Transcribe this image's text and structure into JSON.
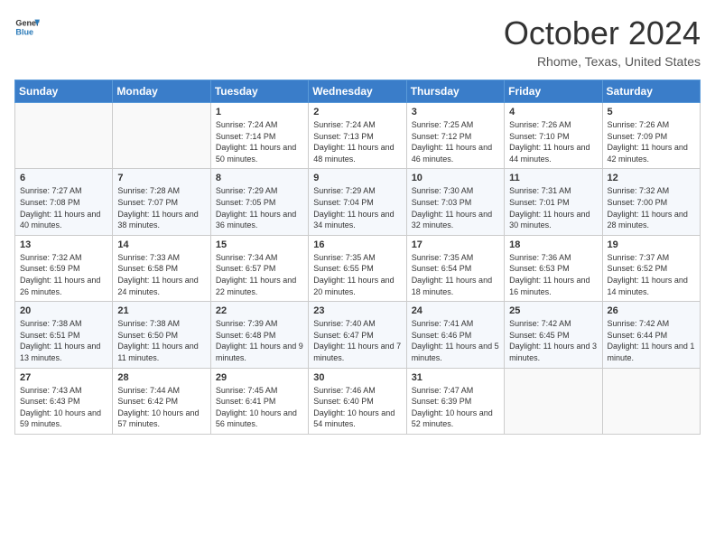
{
  "header": {
    "logo_general": "General",
    "logo_blue": "Blue",
    "month": "October 2024",
    "location": "Rhome, Texas, United States"
  },
  "weekdays": [
    "Sunday",
    "Monday",
    "Tuesday",
    "Wednesday",
    "Thursday",
    "Friday",
    "Saturday"
  ],
  "weeks": [
    [
      {
        "day": "",
        "info": ""
      },
      {
        "day": "",
        "info": ""
      },
      {
        "day": "1",
        "info": "Sunrise: 7:24 AM\nSunset: 7:14 PM\nDaylight: 11 hours and 50 minutes."
      },
      {
        "day": "2",
        "info": "Sunrise: 7:24 AM\nSunset: 7:13 PM\nDaylight: 11 hours and 48 minutes."
      },
      {
        "day": "3",
        "info": "Sunrise: 7:25 AM\nSunset: 7:12 PM\nDaylight: 11 hours and 46 minutes."
      },
      {
        "day": "4",
        "info": "Sunrise: 7:26 AM\nSunset: 7:10 PM\nDaylight: 11 hours and 44 minutes."
      },
      {
        "day": "5",
        "info": "Sunrise: 7:26 AM\nSunset: 7:09 PM\nDaylight: 11 hours and 42 minutes."
      }
    ],
    [
      {
        "day": "6",
        "info": "Sunrise: 7:27 AM\nSunset: 7:08 PM\nDaylight: 11 hours and 40 minutes."
      },
      {
        "day": "7",
        "info": "Sunrise: 7:28 AM\nSunset: 7:07 PM\nDaylight: 11 hours and 38 minutes."
      },
      {
        "day": "8",
        "info": "Sunrise: 7:29 AM\nSunset: 7:05 PM\nDaylight: 11 hours and 36 minutes."
      },
      {
        "day": "9",
        "info": "Sunrise: 7:29 AM\nSunset: 7:04 PM\nDaylight: 11 hours and 34 minutes."
      },
      {
        "day": "10",
        "info": "Sunrise: 7:30 AM\nSunset: 7:03 PM\nDaylight: 11 hours and 32 minutes."
      },
      {
        "day": "11",
        "info": "Sunrise: 7:31 AM\nSunset: 7:01 PM\nDaylight: 11 hours and 30 minutes."
      },
      {
        "day": "12",
        "info": "Sunrise: 7:32 AM\nSunset: 7:00 PM\nDaylight: 11 hours and 28 minutes."
      }
    ],
    [
      {
        "day": "13",
        "info": "Sunrise: 7:32 AM\nSunset: 6:59 PM\nDaylight: 11 hours and 26 minutes."
      },
      {
        "day": "14",
        "info": "Sunrise: 7:33 AM\nSunset: 6:58 PM\nDaylight: 11 hours and 24 minutes."
      },
      {
        "day": "15",
        "info": "Sunrise: 7:34 AM\nSunset: 6:57 PM\nDaylight: 11 hours and 22 minutes."
      },
      {
        "day": "16",
        "info": "Sunrise: 7:35 AM\nSunset: 6:55 PM\nDaylight: 11 hours and 20 minutes."
      },
      {
        "day": "17",
        "info": "Sunrise: 7:35 AM\nSunset: 6:54 PM\nDaylight: 11 hours and 18 minutes."
      },
      {
        "day": "18",
        "info": "Sunrise: 7:36 AM\nSunset: 6:53 PM\nDaylight: 11 hours and 16 minutes."
      },
      {
        "day": "19",
        "info": "Sunrise: 7:37 AM\nSunset: 6:52 PM\nDaylight: 11 hours and 14 minutes."
      }
    ],
    [
      {
        "day": "20",
        "info": "Sunrise: 7:38 AM\nSunset: 6:51 PM\nDaylight: 11 hours and 13 minutes."
      },
      {
        "day": "21",
        "info": "Sunrise: 7:38 AM\nSunset: 6:50 PM\nDaylight: 11 hours and 11 minutes."
      },
      {
        "day": "22",
        "info": "Sunrise: 7:39 AM\nSunset: 6:48 PM\nDaylight: 11 hours and 9 minutes."
      },
      {
        "day": "23",
        "info": "Sunrise: 7:40 AM\nSunset: 6:47 PM\nDaylight: 11 hours and 7 minutes."
      },
      {
        "day": "24",
        "info": "Sunrise: 7:41 AM\nSunset: 6:46 PM\nDaylight: 11 hours and 5 minutes."
      },
      {
        "day": "25",
        "info": "Sunrise: 7:42 AM\nSunset: 6:45 PM\nDaylight: 11 hours and 3 minutes."
      },
      {
        "day": "26",
        "info": "Sunrise: 7:42 AM\nSunset: 6:44 PM\nDaylight: 11 hours and 1 minute."
      }
    ],
    [
      {
        "day": "27",
        "info": "Sunrise: 7:43 AM\nSunset: 6:43 PM\nDaylight: 10 hours and 59 minutes."
      },
      {
        "day": "28",
        "info": "Sunrise: 7:44 AM\nSunset: 6:42 PM\nDaylight: 10 hours and 57 minutes."
      },
      {
        "day": "29",
        "info": "Sunrise: 7:45 AM\nSunset: 6:41 PM\nDaylight: 10 hours and 56 minutes."
      },
      {
        "day": "30",
        "info": "Sunrise: 7:46 AM\nSunset: 6:40 PM\nDaylight: 10 hours and 54 minutes."
      },
      {
        "day": "31",
        "info": "Sunrise: 7:47 AM\nSunset: 6:39 PM\nDaylight: 10 hours and 52 minutes."
      },
      {
        "day": "",
        "info": ""
      },
      {
        "day": "",
        "info": ""
      }
    ]
  ]
}
